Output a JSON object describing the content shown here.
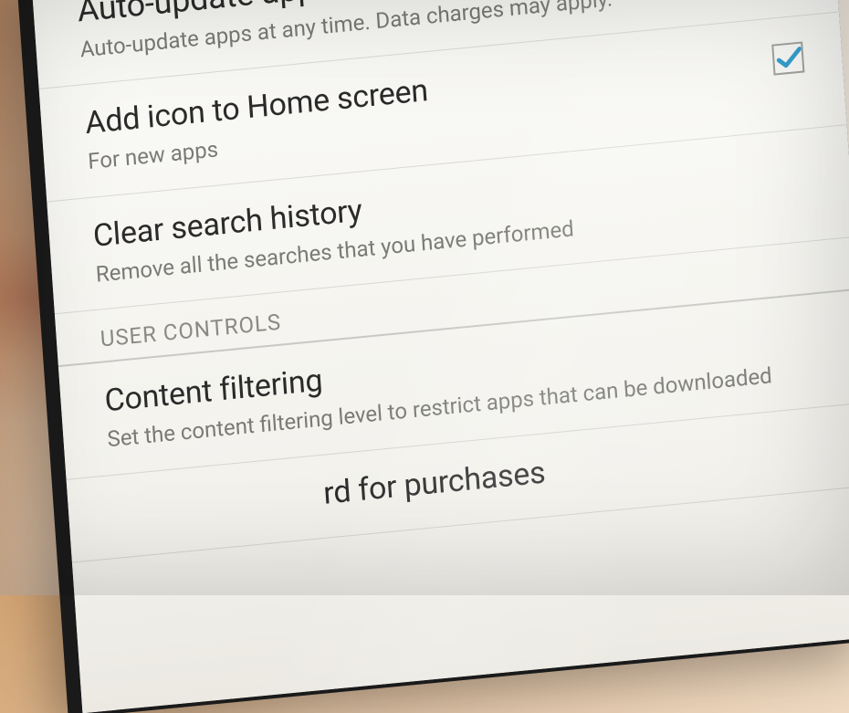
{
  "settings": {
    "auto_update": {
      "title": "Auto-update apps",
      "subtitle": "Auto-update apps at any time. Data charges may apply."
    },
    "add_icon": {
      "title": "Add icon to Home screen",
      "subtitle": "For new apps",
      "checked": true
    },
    "clear_search": {
      "title": "Clear search history",
      "subtitle": "Remove all the searches that you have performed"
    },
    "section_user_controls": "USER CONTROLS",
    "content_filtering": {
      "title": "Content filtering",
      "subtitle": "Set the content filtering level to restrict apps that can be downloaded"
    },
    "password_purchases": {
      "title_partial": "rd for purchases"
    }
  },
  "colors": {
    "check": "#2196c9"
  }
}
